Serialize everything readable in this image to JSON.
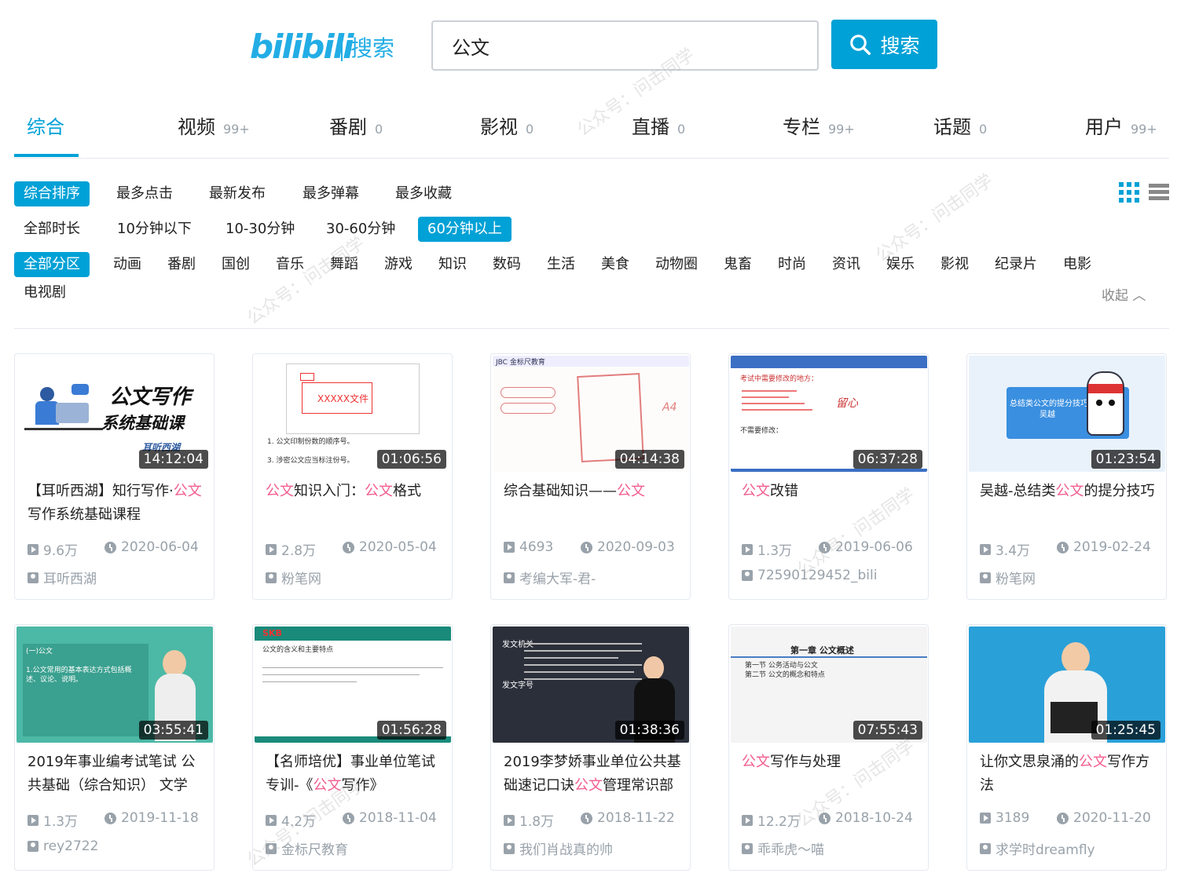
{
  "header": {
    "logo_brand": "bilibili",
    "logo_sub": "搜索",
    "search_value": "公文",
    "search_button": "搜索",
    "accent_color": "#00a1d6"
  },
  "tabs": [
    {
      "label": "综合",
      "count": ""
    },
    {
      "label": "视频",
      "count": "99+"
    },
    {
      "label": "番剧",
      "count": "0"
    },
    {
      "label": "影视",
      "count": "0"
    },
    {
      "label": "直播",
      "count": "0"
    },
    {
      "label": "专栏",
      "count": "99+"
    },
    {
      "label": "话题",
      "count": "0"
    },
    {
      "label": "用户",
      "count": "99+"
    }
  ],
  "sort_options": [
    "综合排序",
    "最多点击",
    "最新发布",
    "最多弹幕",
    "最多收藏"
  ],
  "duration_options": [
    "全部时长",
    "10分钟以下",
    "10-30分钟",
    "30-60分钟",
    "60分钟以上"
  ],
  "zone_options": [
    "全部分区",
    "动画",
    "番剧",
    "国创",
    "音乐",
    "舞蹈",
    "游戏",
    "知识",
    "数码",
    "生活",
    "美食",
    "动物圈",
    "鬼畜",
    "时尚",
    "资讯",
    "娱乐",
    "影视",
    "纪录片",
    "电影"
  ],
  "zone_options_row2": [
    "电视剧"
  ],
  "collapse_label": "收起",
  "videos": [
    {
      "title_parts": [
        "【耳听西湖】知行写作·",
        "公文",
        "写作系统基础课程"
      ],
      "duration": "14:12:04",
      "views": "9.6万",
      "date": "2020-06-04",
      "uploader": "耳听西湖",
      "thumb_text_1": "公文写作",
      "thumb_text_2": "系统基础课",
      "thumb_text_3": "耳听西湖"
    },
    {
      "title_parts": [
        "",
        "公文",
        "知识入门：",
        "公文",
        "格式"
      ],
      "duration": "01:06:56",
      "views": "2.8万",
      "date": "2020-05-04",
      "uploader": "粉笔网",
      "thumb_text_1": "XXXXX文件",
      "thumb_text_2": "1. 公文印制份数的顺序号。",
      "thumb_text_3": "3. 涉密公文应当标注份号。"
    },
    {
      "title_parts": [
        "综合基础知识——",
        "公文"
      ],
      "duration": "04:14:38",
      "views": "4693",
      "date": "2020-09-03",
      "uploader": "考编大军-君-",
      "thumb_text_1": "JBC 金标尺教育",
      "thumb_text_2": "A4",
      "thumb_text_3": ""
    },
    {
      "title_parts": [
        "",
        "公文",
        "改错"
      ],
      "duration": "06:37:28",
      "views": "1.3万",
      "date": "2019-06-06",
      "uploader": "72590129452_bili",
      "thumb_text_1": "考试中需要修改的地方：",
      "thumb_text_2": "不需要修改：",
      "thumb_text_3": "留心"
    },
    {
      "title_parts": [
        "吴越-总结类",
        "公文",
        "的提分技巧"
      ],
      "duration": "01:23:54",
      "views": "3.4万",
      "date": "2019-02-24",
      "uploader": "粉笔网",
      "thumb_text_1": "总结类公文的提分技巧",
      "thumb_text_2": "吴越",
      "thumb_text_3": ""
    },
    {
      "title_parts": [
        "2019年事业编考试笔试 公共基础（综合知识） 文学"
      ],
      "duration": "03:55:41",
      "views": "1.3万",
      "date": "2019-11-18",
      "uploader": "rey2722",
      "thumb_text_1": "(一)公文",
      "thumb_text_2": "1.公文常用的基本表达方式包括概述、议论、说明。",
      "thumb_text_3": ""
    },
    {
      "title_parts": [
        "【名师培优】事业单位笔试专训-《",
        "公文",
        "写作》"
      ],
      "duration": "01:56:28",
      "views": "4.2万",
      "date": "2018-11-04",
      "uploader": "金标尺教育",
      "thumb_text_1": "SKB",
      "thumb_text_2": "公文的含义和主要特点",
      "thumb_text_3": ""
    },
    {
      "title_parts": [
        "2019李梦娇事业单位公共基础速记口诀",
        "公文",
        "管理常识部"
      ],
      "duration": "01:38:36",
      "views": "1.8万",
      "date": "2018-11-22",
      "uploader": "我们肖战真的帅",
      "thumb_text_1": "发文机关",
      "thumb_text_2": "发文字号",
      "thumb_text_3": ""
    },
    {
      "title_parts": [
        "",
        "公文",
        "写作与处理"
      ],
      "duration": "07:55:43",
      "views": "12.2万",
      "date": "2018-10-24",
      "uploader": "乖乖虎～喵",
      "thumb_text_1": "第一章 公文概述",
      "thumb_text_2": "第一节 公务活动与公文",
      "thumb_text_3": "第二节 公文的概念和特点"
    },
    {
      "title_parts": [
        "让你文思泉涌的",
        "公文",
        "写作方法"
      ],
      "duration": "01:25:45",
      "views": "3189",
      "date": "2020-11-20",
      "uploader": "求学时dreamfly",
      "thumb_text_1": "",
      "thumb_text_2": "",
      "thumb_text_3": ""
    }
  ],
  "highlight_color": "#f25d8e",
  "watermark": "公众号：问击同学"
}
